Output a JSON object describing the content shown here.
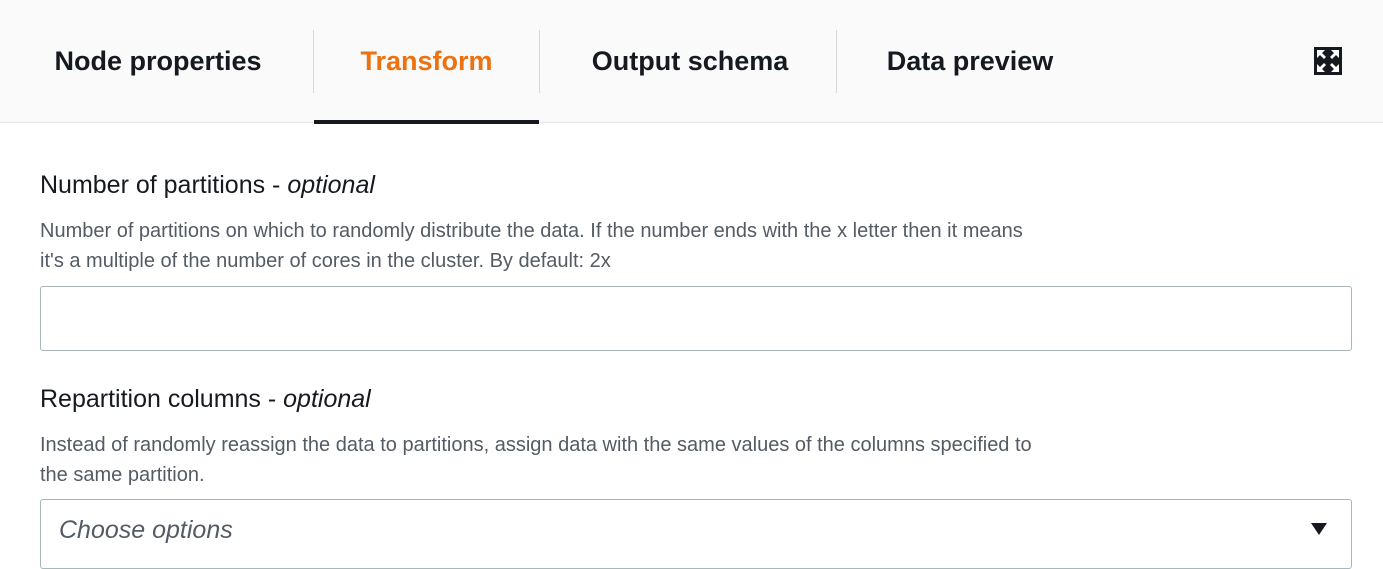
{
  "tabs": [
    {
      "label": "Node properties",
      "active": false
    },
    {
      "label": "Transform",
      "active": true
    },
    {
      "label": "Output schema",
      "active": false
    },
    {
      "label": "Data preview",
      "active": false
    }
  ],
  "expand_icon": "expand-icon",
  "colors": {
    "active_tab": "#ec7211",
    "text": "#16191f",
    "muted_text": "#545b64",
    "border": "#aab7b8"
  },
  "partitions": {
    "label": "Number of partitions - ",
    "label_optional": "optional",
    "description_line1": "Number of partitions on which to randomly distribute the data. If the number ends with the x letter then it means",
    "description_line2": "it's a multiple of the number of cores in the cluster. By default: 2x",
    "value": ""
  },
  "repartition": {
    "label": "Repartition columns - ",
    "label_optional": "optional",
    "description_line1": "Instead of randomly reassign the data to partitions, assign data with the same values of the columns specified to",
    "description_line2": "the same partition.",
    "placeholder": "Choose options",
    "caret_icon": "caret-down-icon"
  }
}
